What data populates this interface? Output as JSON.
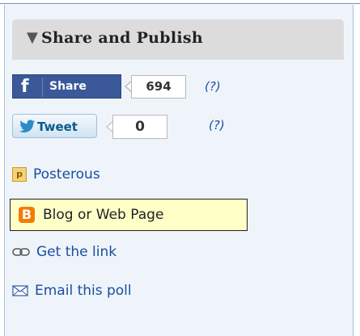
{
  "panel": {
    "title": "Share and Publish",
    "collapse_icon": "triangle-down-icon"
  },
  "facebook": {
    "logo": "f",
    "label": "Share",
    "count": "694",
    "help": "(?)"
  },
  "twitter": {
    "label": "Tweet",
    "count": "0",
    "help": "(?)"
  },
  "links": {
    "posterous": {
      "icon_letter": "p",
      "label": "Posterous"
    },
    "blog": {
      "icon_letter": "B",
      "label": "Blog or Web Page"
    },
    "get_link": {
      "label": "Get the link"
    },
    "email": {
      "label": "Email this poll"
    }
  },
  "colors": {
    "facebook_blue": "#3b5998",
    "link_blue": "#1a4ea0",
    "highlight_yellow": "#ffffc8",
    "blogger_orange": "#f57c00",
    "panel_bg": "#eef4fa",
    "header_bg": "#dcdcdc"
  }
}
